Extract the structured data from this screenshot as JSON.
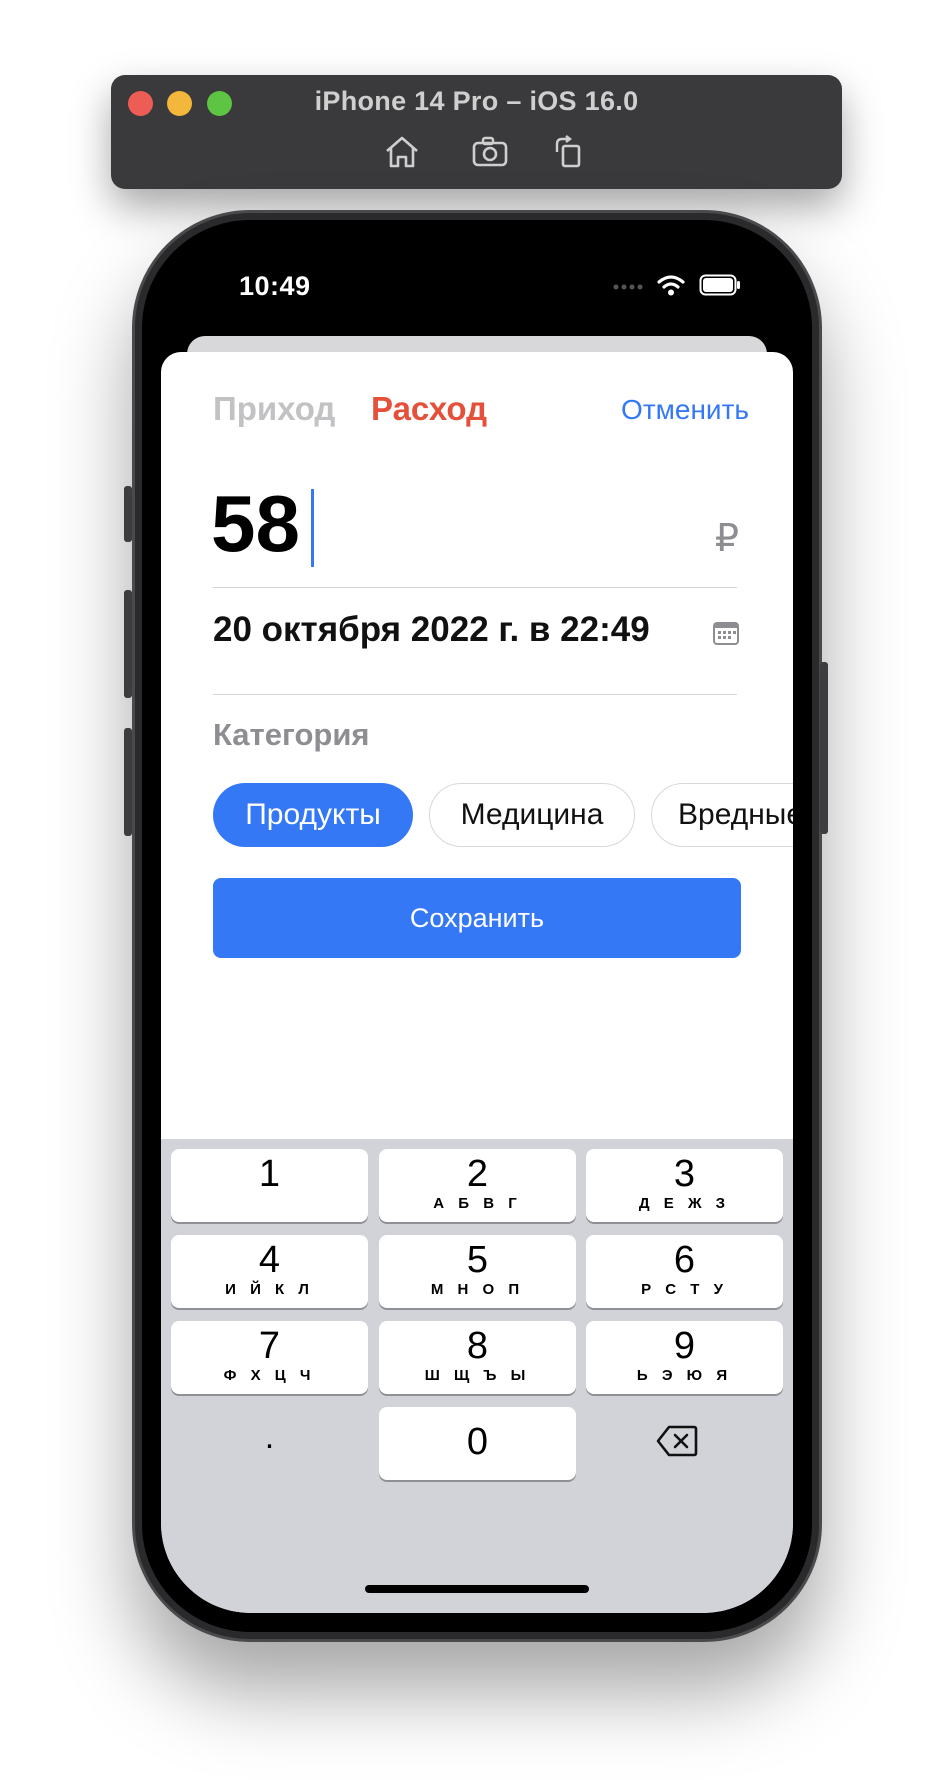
{
  "simulator": {
    "title": "iPhone 14 Pro – iOS 16.0",
    "toolbar_icons": [
      "home-icon",
      "screenshot-icon",
      "rotate-icon"
    ]
  },
  "status_bar": {
    "time": "10:49",
    "icons": [
      "cellular-icon",
      "wifi-icon",
      "battery-icon"
    ]
  },
  "form": {
    "segment_income": "Приход",
    "segment_expense": "Расход",
    "selected_segment": "Расход",
    "cancel_label": "Отменить",
    "amount_value": "58",
    "currency_symbol": "₽",
    "date_value": "20 октября 2022 г. в 22:49",
    "category_title": "Категория",
    "categories": [
      {
        "label": "Продукты",
        "selected": true
      },
      {
        "label": "Медицина",
        "selected": false
      },
      {
        "label": "Вредные",
        "selected": false
      }
    ],
    "save_label": "Сохранить"
  },
  "keyboard": {
    "keys": [
      {
        "num": "1",
        "letters": ""
      },
      {
        "num": "2",
        "letters": "А Б В Г"
      },
      {
        "num": "3",
        "letters": "Д Е Ж З"
      },
      {
        "num": "4",
        "letters": "И Й К Л"
      },
      {
        "num": "5",
        "letters": "М Н О П"
      },
      {
        "num": "6",
        "letters": "Р С Т У"
      },
      {
        "num": "7",
        "letters": "Ф Х Ц Ч"
      },
      {
        "num": "8",
        "letters": "Ш Щ Ъ Ы"
      },
      {
        "num": "9",
        "letters": "Ь Э Ю Я"
      }
    ],
    "dot": ".",
    "zero": "0"
  },
  "colors": {
    "accent_blue": "#3478f6",
    "expense_red": "#e5503b",
    "muted_gray": "#8e8e92",
    "keyboard_bg": "#d1d3d9"
  }
}
